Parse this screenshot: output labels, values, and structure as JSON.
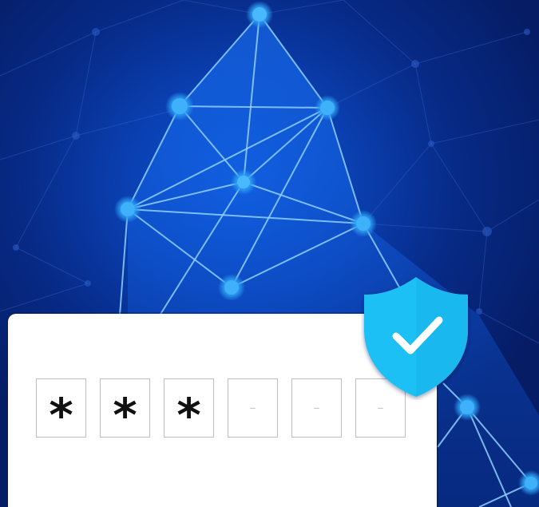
{
  "pin_entry": {
    "slots": [
      {
        "char": "*",
        "filled": true
      },
      {
        "char": "*",
        "filled": true
      },
      {
        "char": "*",
        "filled": true
      },
      {
        "char": "–",
        "filled": false
      },
      {
        "char": "–",
        "filled": false
      },
      {
        "char": "–",
        "filled": false
      }
    ]
  },
  "icons": {
    "shield": "shield-check-icon"
  },
  "colors": {
    "background_dark": "#061a5e",
    "background_glow": "#0d55d4",
    "network_line": "#7cc6ff",
    "network_node": "#35a8f5",
    "shield": "#1ec0f5",
    "check": "#ffffff",
    "card": "#ffffff",
    "slot_border": "#bdbdbd"
  }
}
